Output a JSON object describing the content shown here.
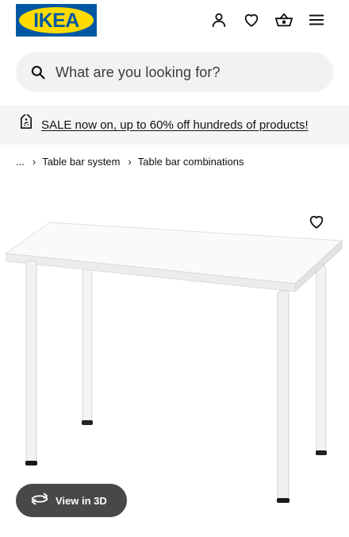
{
  "header": {
    "logo_text": "IKEA",
    "icons": [
      "user-icon",
      "heart-icon",
      "basket-icon",
      "menu-icon"
    ]
  },
  "search": {
    "placeholder": "What are you looking for?"
  },
  "banner": {
    "text": "SALE now on, up to 60% off hundreds of products!",
    "icon": "price-tag-icon"
  },
  "breadcrumb": {
    "ellipsis": "...",
    "items": [
      "Table bar system",
      "Table bar combinations"
    ]
  },
  "product": {
    "image": "white-desk-with-four-legs"
  },
  "view3d": {
    "label": "View in 3D"
  },
  "colors": {
    "brand_blue": "#0058a3",
    "brand_yellow": "#ffdb00",
    "view3d_bg": "#484848"
  }
}
